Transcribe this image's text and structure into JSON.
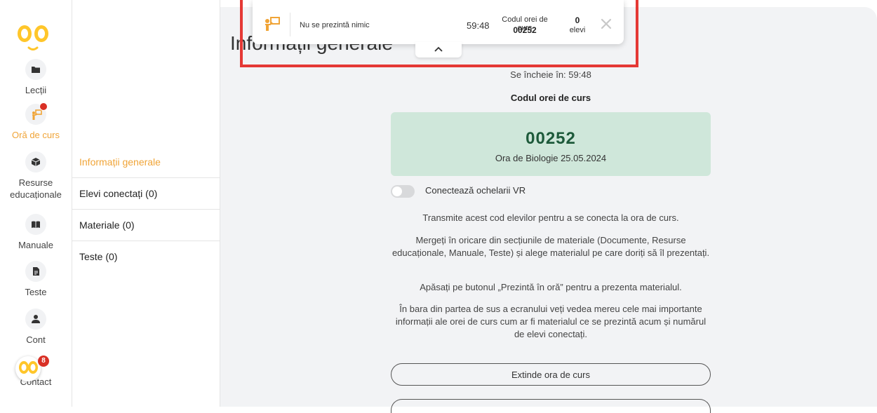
{
  "nav": {
    "items": [
      {
        "label": "Lecții",
        "icon": "folder-icon"
      },
      {
        "label": "Oră de curs",
        "icon": "teacher-board-icon",
        "active": true,
        "has_notification": true
      },
      {
        "label": "Resurse educaționale",
        "icon": "cube-icon"
      },
      {
        "label": "Manuale",
        "icon": "book-icon"
      },
      {
        "label": "Teste",
        "icon": "document-icon"
      },
      {
        "label": "Cont",
        "icon": "user-icon"
      }
    ],
    "contact": {
      "label": "Contact",
      "badge": "8"
    },
    "accent_color": "#f0a437"
  },
  "subnav": {
    "items": [
      {
        "label": "Informații generale",
        "active": true
      },
      {
        "label": "Elevi conectați (0)"
      },
      {
        "label": "Materiale (0)"
      },
      {
        "label": "Teste (0)"
      }
    ]
  },
  "topbar": {
    "presenting_text": "Nu se prezintă nimic",
    "time": "59:48",
    "code_label": "Codul orei de curs",
    "code_value": "00252",
    "student_count": "0",
    "student_label": "elevi"
  },
  "main": {
    "title": "Informații generale",
    "ends_in": "Se încheie în: 59:48",
    "code_label": "Codul orei de curs",
    "code_value": "00252",
    "lesson_name": "Ora de Biologie 25.05.2024",
    "vr_toggle_label": "Conectează ochelarii VR",
    "vr_toggle_on": false,
    "paragraphs": [
      "Transmite acest cod elevilor pentru a se conecta la ora de curs.",
      "Mergeți în oricare din secțiunile de materiale (Documente, Resurse educaționale, Manuale, Teste) și alege materialul pe care doriți să îl prezentați.",
      "Apăsați pe butonul „Prezintă în oră” pentru a prezenta materialul.",
      "În bara din partea de sus a ecranului veți vedea mereu cele mai importante informații ale orei de curs cum ar fi materialul ce se prezintă acum și numărul de elevi conectați."
    ],
    "extend_button": "Extinde ora de curs"
  }
}
